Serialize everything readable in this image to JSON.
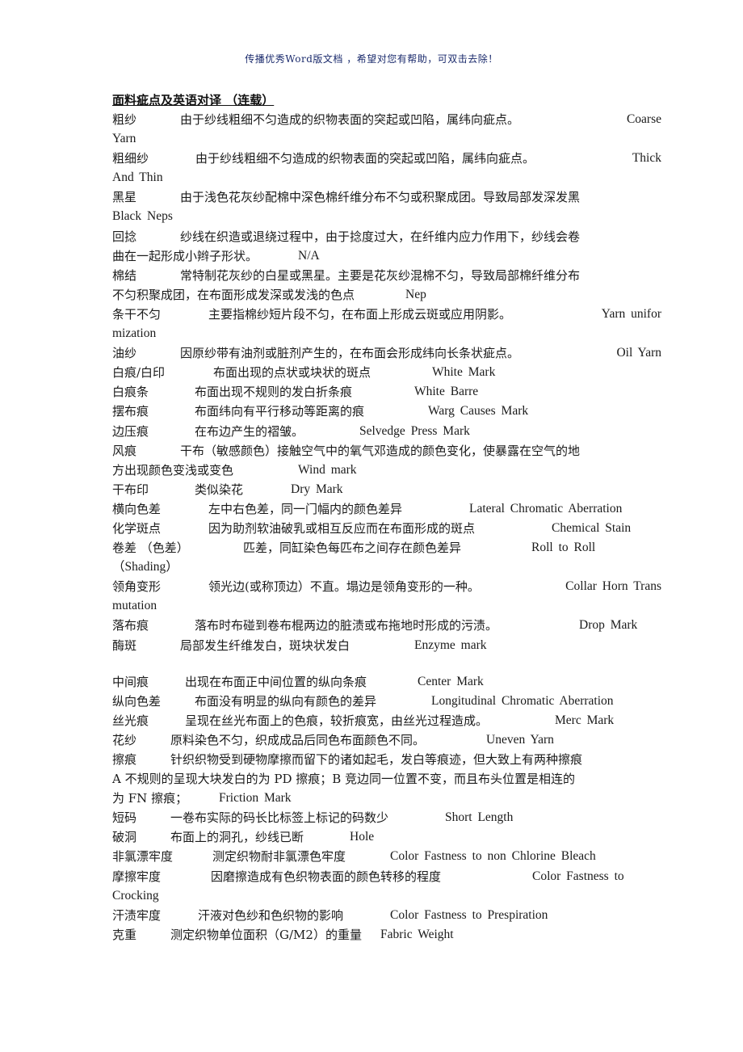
{
  "header_notice": "传播优秀Word版文档 ，希望对您有帮助，可双击去除！",
  "title": "面料疵点及英语对译 （连载）",
  "lines": [
    {
      "term": "粗纱",
      "desc": "由于纱线粗细不匀造成的织物表面的突起或凹陷，属纬向疵点。",
      "en": "Coarse"
    },
    {
      "term": "",
      "desc": "",
      "en": "Yarn",
      "cont": true
    },
    {
      "term": "粗细纱",
      "desc": "由于纱线粗细不匀造成的织物表面的突起或凹陷，属纬向疵点。",
      "en": "Thick"
    },
    {
      "term": "",
      "desc": "",
      "en": "And  Thin",
      "cont": true
    },
    {
      "term": "黑星",
      "desc": "由于浅色花灰纱配棉中深色棉纤维分布不匀或积聚成团。导致局部发深发黑",
      "en": ""
    },
    {
      "term": "",
      "desc": "",
      "en": "Black  Neps",
      "cont": true
    },
    {
      "term": "回捻",
      "desc": "纱线在织造或退绕过程中，由于捻度过大，在纤维内应力作用下，纱线会卷",
      "en": ""
    },
    {
      "term": "",
      "desc": "曲在一起形成小辫子形状。",
      "en": "N/A",
      "cont": true
    },
    {
      "term": "棉结",
      "desc": "常特制花灰纱的白星或黑星。主要是花灰纱混棉不匀，导致局部棉纤维分布",
      "en": ""
    },
    {
      "term": "",
      "desc": "不匀积聚成团，在布面形成发深或发浅的色点",
      "en": "Nep",
      "cont": true
    },
    {
      "term": "条干不匀",
      "desc": "主要指棉纱短片段不匀，在布面上形成云斑或应用阴影。",
      "en": "Yarn  unifor"
    },
    {
      "term": "",
      "desc": "",
      "en": "mization",
      "cont": true
    },
    {
      "term": "油纱",
      "desc": "因原纱带有油剂或脏剂产生的，在布面会形成纬向长条状疵点。",
      "en": "Oil  Yarn"
    },
    {
      "term": "白痕/白印",
      "desc": "布面出现的点状或块状的斑点",
      "en": "White  Mark"
    },
    {
      "term": "白痕条",
      "desc": "布面出现不规则的发白折条痕",
      "en": "White  Barre"
    },
    {
      "term": "摆布痕",
      "desc": "布面纬向有平行移动等距离的痕",
      "en": "Warg  Causes  Mark"
    },
    {
      "term": "边压痕",
      "desc": "在布边产生的褶皱。",
      "en": "Selvedge  Press  Mark"
    },
    {
      "term": "风痕",
      "desc": "干布（敏感颜色）接触空气中的氧气邓造成的颜色变化，使暴露在空气的地",
      "en": ""
    },
    {
      "term": "",
      "desc": "方出现颜色变浅或变色",
      "en": "Wind  mark",
      "cont": true
    },
    {
      "term": "干布印",
      "desc": "类似染花",
      "en": "Dry  Mark"
    },
    {
      "term": "横向色差",
      "desc": "左中右色差，同一门幅内的颜色差异",
      "en": "Lateral  Chromatic  Aberration"
    },
    {
      "term": "化学斑点",
      "desc": "因为助剂软油破乳或相互反应而在布面形成的斑点",
      "en": "Chemical  Stain"
    },
    {
      "term": "卷差 （色差）",
      "desc": "匹差，同缸染色每匹布之间存在颜色差异",
      "en": "Roll  to  Roll"
    },
    {
      "term": "",
      "desc": "",
      "en": "（Shading）",
      "cont": true
    },
    {
      "term": "领角变形",
      "desc": "领光边(或称顶边）不直。塌边是领角变形的一种。",
      "en": "Collar  Horn  Trans"
    },
    {
      "term": "",
      "desc": "",
      "en": "mutation",
      "cont": true
    },
    {
      "term": "落布痕",
      "desc": "落布时布碰到卷布棍两边的脏渍或布拖地时形成的污渍。",
      "en": "Drop  Mark"
    },
    {
      "term": "酶斑",
      "desc": "局部发生纤维发白，斑块状发白",
      "en": "Enzyme  mark"
    },
    {
      "blank": true
    },
    {
      "term": "中间痕",
      "desc": "出现在布面正中间位置的纵向条痕",
      "en": "Center Mark"
    },
    {
      "term": "纵向色差",
      "desc": "布面没有明显的纵向有颜色的差异",
      "en": "Longitudinal Chromatic Aberration"
    },
    {
      "term": "丝光痕",
      "desc": "呈现在丝光布面上的色痕，较折痕宽，由丝光过程造成。",
      "en": "Merc Mark"
    },
    {
      "term": "花纱",
      "desc": "原料染色不匀，织成成品后同色布面颜色不同。",
      "en": "Uneven Yarn"
    },
    {
      "term": "擦痕",
      "desc": "针织织物受到硬物摩擦而留下的诸如起毛，发白等痕迹，但大致上有两种擦痕",
      "en": ""
    },
    {
      "term": "",
      "desc": "A  不规则的呈现大块发白的为 PD 擦痕；B  竞边同一位置不变，而且布头位置是相连的",
      "en": "",
      "cont": true
    },
    {
      "term": "",
      "desc": "为 FN 擦痕；",
      "en": "Friction Mark",
      "cont": true
    },
    {
      "term": "短码",
      "desc": "一卷布实际的码长比标签上标记的码数少",
      "en": "Short Length"
    },
    {
      "term": "破洞",
      "desc": "布面上的洞孔，纱线已断",
      "en": "Hole"
    },
    {
      "term": "非氯漂牢度",
      "desc": "测定织物耐非氯漂色牢度",
      "en": "Color Fastness to non Chlorine Bleach"
    },
    {
      "term": "摩擦牢度",
      "desc": "因磨擦造成有色织物表面的颜色转移的程度",
      "en": "Color Fastness to"
    },
    {
      "term": "",
      "desc": "",
      "en": "Crocking",
      "cont": true
    },
    {
      "term": "汗渍牢度",
      "desc": "汗液对色纱和色织物的影响",
      "en": "Color Fastness to Prespiration"
    },
    {
      "term": "克重",
      "desc": "测定织物单位面积（G/M2）的重量",
      "en": "Fabric Weight"
    }
  ]
}
